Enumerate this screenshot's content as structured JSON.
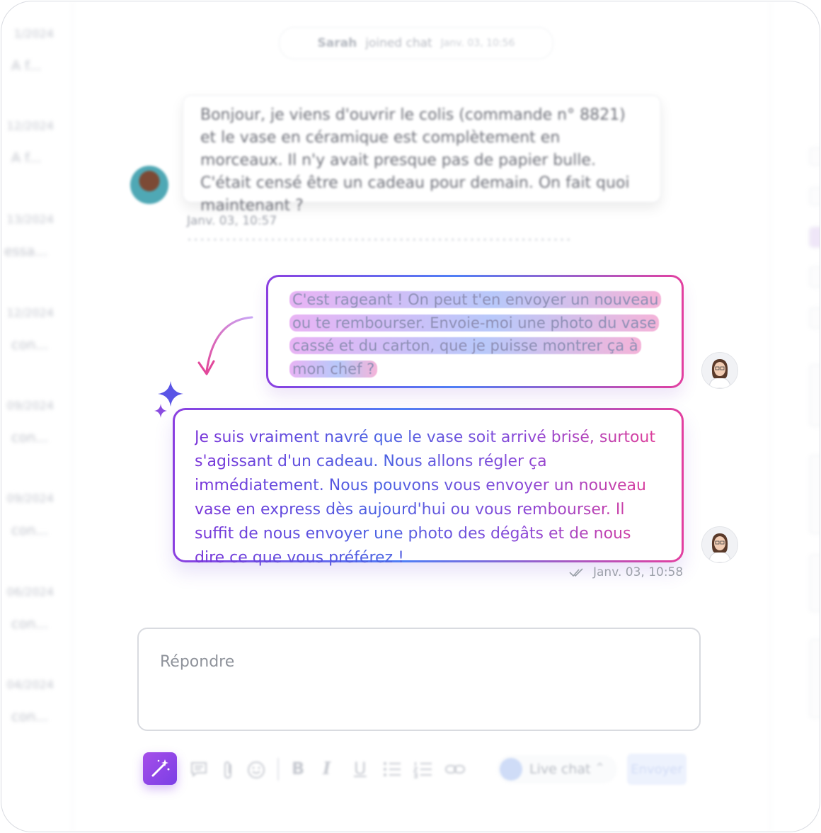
{
  "conversation_list": [
    {
      "date": "1/2024",
      "preview": "A f..."
    },
    {
      "date": "12/2024",
      "preview": "A f..."
    },
    {
      "date": "13/2024",
      "preview": "essa..."
    },
    {
      "date": "12/2024",
      "preview": "con..."
    },
    {
      "date": "09/2024",
      "preview": "con..."
    },
    {
      "date": "09/2024",
      "preview": "con..."
    },
    {
      "date": "06/2024",
      "preview": "con..."
    },
    {
      "date": "04/2024",
      "preview": "con..."
    }
  ],
  "system_event": {
    "name": "Sarah",
    "action": "joined chat",
    "time": "Janv. 03, 10:56"
  },
  "customer_message": {
    "text": "Bonjour, je viens d'ouvrir le colis (commande n° 8821) et le vase en céramique est complètement en morceaux. Il n'y avait presque pas de papier bulle. C'était censé être un cadeau pour demain. On fait quoi maintenant ?",
    "time": "Janv. 03, 10:57"
  },
  "agent_draft": {
    "text": "C'est rageant ! On peut t'en envoyer un nouveau ou te rembourser. Envoie-moi une photo du vase cassé et du carton, que je puisse montrer ça à mon chef ?"
  },
  "agent_rewrite": {
    "text": "Je suis vraiment navré que le vase soit arrivé brisé, surtout s'agissant d'un cadeau. Nous allons régler ça immédiatement. Nous pouvons vous envoyer un nouveau vase en express dès aujourd'hui ou vous rembourser. Il suffit de nous envoyer une photo des dégâts et de nous dire ce que vous préférez !",
    "time": "Janv. 03, 10:58"
  },
  "reply": {
    "placeholder": "Répondre"
  },
  "toolbar": {
    "icons": [
      "magic-wand-icon",
      "note-icon",
      "paperclip-icon",
      "emoji-icon",
      "bold-icon",
      "italic-icon",
      "underline-icon",
      "bullet-list-icon",
      "numbered-list-icon",
      "link-icon"
    ],
    "bold_glyph": "B",
    "italic_glyph": "I",
    "underline_glyph": "U",
    "channel_label": "Live chat",
    "send_label": "Envoyer"
  },
  "colors": {
    "gradient_purple": "#8b3fe0",
    "gradient_blue": "#4f7ef5",
    "gradient_pink": "#e33fa0",
    "ai_button": "#8e45e7"
  }
}
